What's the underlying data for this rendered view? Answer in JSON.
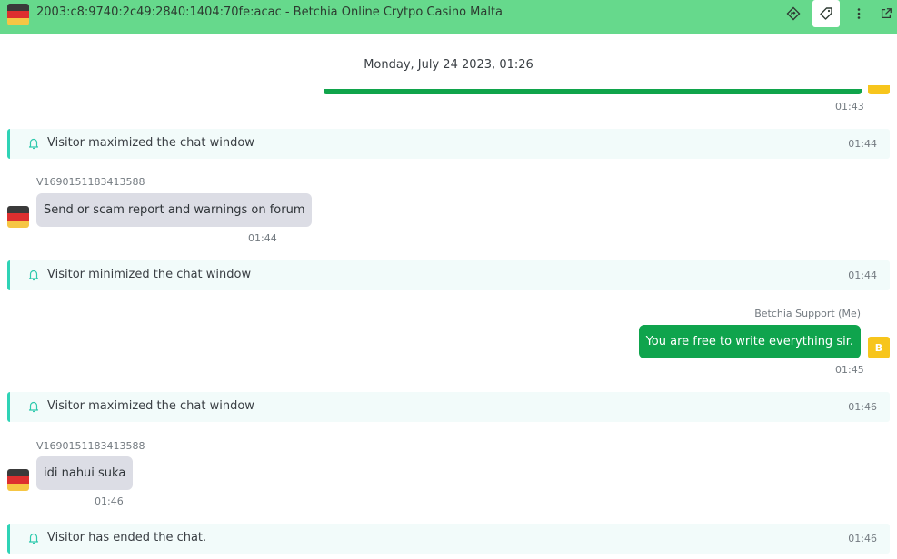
{
  "header": {
    "title": "2003:c8:9740:2c49:2840:1404:70fe:acac - Betchia Online Crytpo Casino Malta",
    "flag": "germany-flag",
    "icons": [
      "routing-icon",
      "tag-icon",
      "more-vert-icon",
      "external-link-icon"
    ]
  },
  "chat": {
    "date_separator": "Monday, July 24 2023, 01:26",
    "prev_message_time": "01:43",
    "events": [
      {
        "text": "Visitor maximized the chat window",
        "time": "01:44"
      },
      {
        "text": "Visitor minimized the chat window",
        "time": "01:44"
      },
      {
        "text": "Visitor maximized the chat window",
        "time": "01:46"
      },
      {
        "text": "Visitor has ended the chat.",
        "time": "01:46"
      }
    ],
    "visitor_messages": [
      {
        "sender": "V1690151183413588",
        "text": "Send or scam report and warnings on forum",
        "time": "01:44"
      },
      {
        "sender": "V1690151183413588",
        "text": "idi nahui suka",
        "time": "01:46"
      }
    ],
    "agent_message": {
      "sender": "Betchia Support (Me)",
      "text": "You are free to write everything sir.",
      "time": "01:45",
      "avatar_initial": "B"
    }
  },
  "colors": {
    "header_bg": "#66d98c",
    "agent_bubble": "#0fa44d",
    "visitor_bubble": "#dcdde5",
    "event_accent": "#2fd3b6",
    "avatar": "#f7c51c"
  }
}
